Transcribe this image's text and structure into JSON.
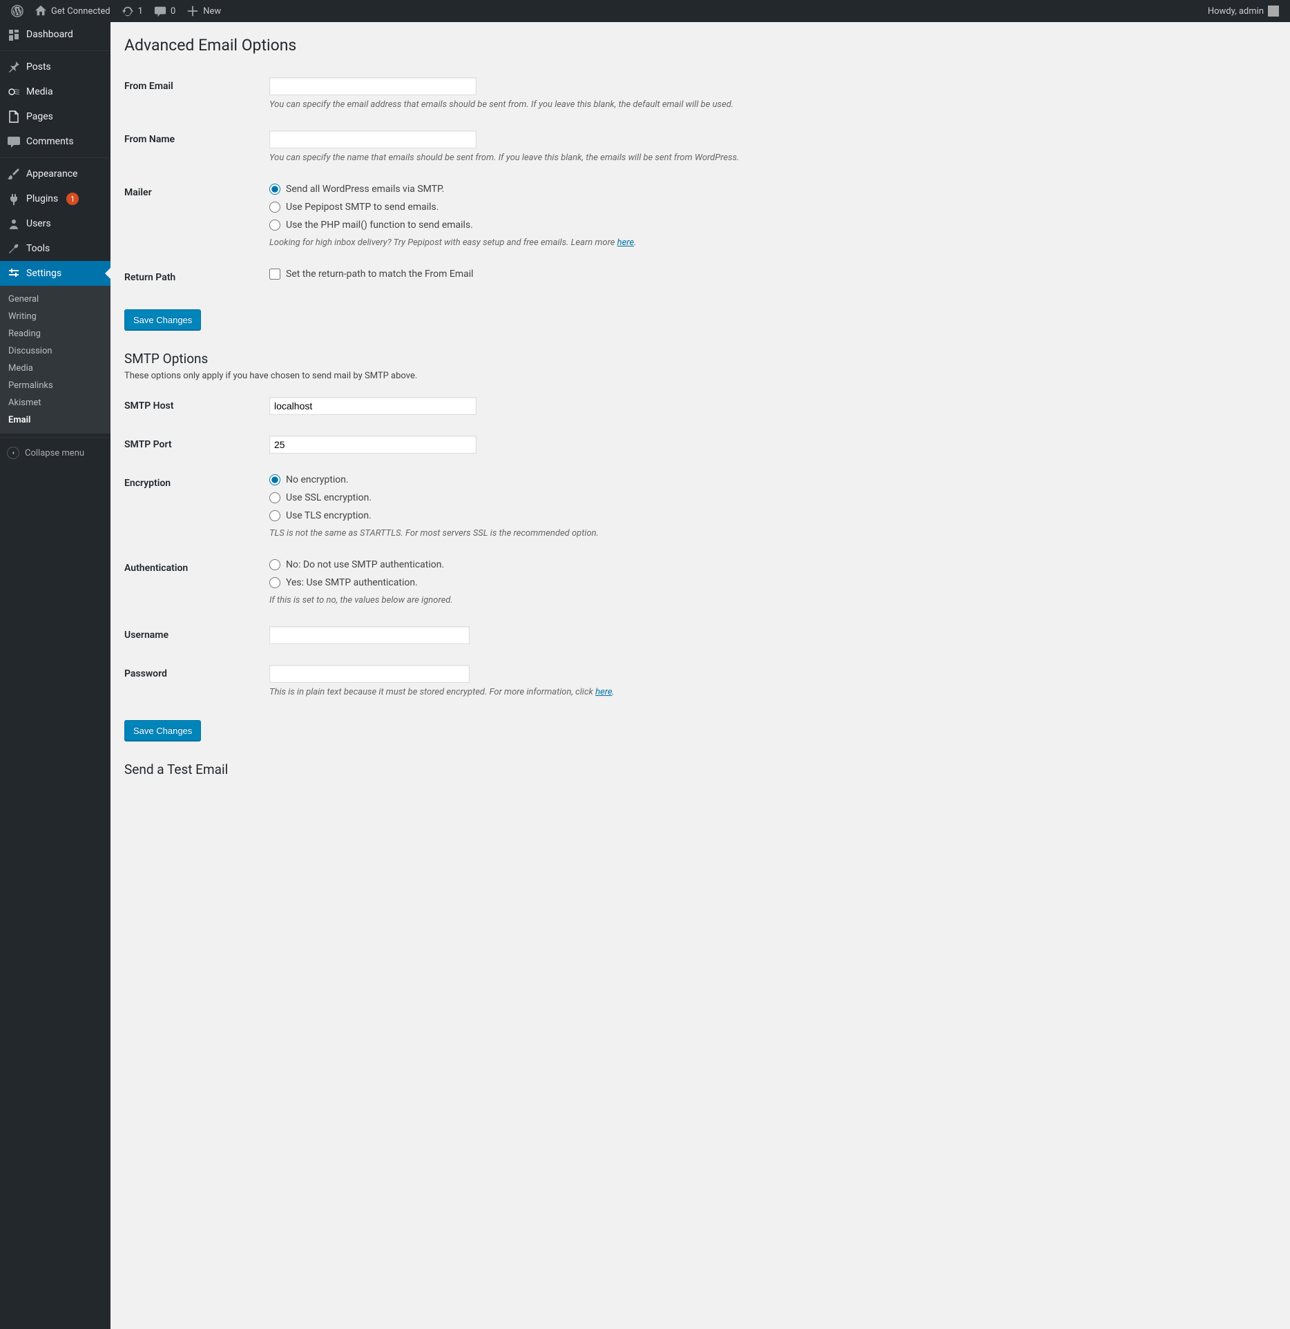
{
  "adminbar": {
    "site_name": "Get Connected",
    "updates_count": "1",
    "comments_count": "0",
    "new_label": "New",
    "howdy": "Howdy, admin"
  },
  "sidebar": {
    "items": [
      {
        "label": "Dashboard"
      },
      {
        "label": "Posts"
      },
      {
        "label": "Media"
      },
      {
        "label": "Pages"
      },
      {
        "label": "Comments"
      },
      {
        "label": "Appearance"
      },
      {
        "label": "Plugins",
        "badge": "1"
      },
      {
        "label": "Users"
      },
      {
        "label": "Tools"
      },
      {
        "label": "Settings"
      }
    ],
    "submenu": [
      {
        "label": "General"
      },
      {
        "label": "Writing"
      },
      {
        "label": "Reading"
      },
      {
        "label": "Discussion"
      },
      {
        "label": "Media"
      },
      {
        "label": "Permalinks"
      },
      {
        "label": "Akismet"
      },
      {
        "label": "Email"
      }
    ],
    "collapse_label": "Collapse menu"
  },
  "page": {
    "title": "Advanced Email Options",
    "section2_title": "SMTP Options",
    "section2_note": "These options only apply if you have chosen to send mail by SMTP above.",
    "section3_title": "Send a Test Email",
    "fields": {
      "from_email": {
        "label": "From Email",
        "value": "",
        "desc": "You can specify the email address that emails should be sent from. If you leave this blank, the default email will be used."
      },
      "from_name": {
        "label": "From Name",
        "value": "",
        "desc": "You can specify the name that emails should be sent from. If you leave this blank, the emails will be sent from WordPress."
      },
      "mailer": {
        "label": "Mailer",
        "opts": [
          "Send all WordPress emails via SMTP.",
          "Use Pepipost SMTP to send emails.",
          "Use the PHP mail() function to send emails."
        ],
        "desc_pre": "Looking for high inbox delivery? Try Pepipost with easy setup and free emails. Learn more ",
        "desc_link": "here"
      },
      "return_path": {
        "label": "Return Path",
        "check_label": "Set the return-path to match the From Email"
      },
      "smtp_host": {
        "label": "SMTP Host",
        "value": "localhost"
      },
      "smtp_port": {
        "label": "SMTP Port",
        "value": "25"
      },
      "encryption": {
        "label": "Encryption",
        "opts": [
          "No encryption.",
          "Use SSL encryption.",
          "Use TLS encryption."
        ],
        "desc": "TLS is not the same as STARTTLS. For most servers SSL is the recommended option."
      },
      "auth": {
        "label": "Authentication",
        "opts": [
          "No: Do not use SMTP authentication.",
          "Yes: Use SMTP authentication."
        ],
        "desc": "If this is set to no, the values below are ignored."
      },
      "username": {
        "label": "Username",
        "value": ""
      },
      "password": {
        "label": "Password",
        "value": "",
        "desc_pre": "This is in plain text because it must be stored encrypted. For more information, click ",
        "desc_link": "here"
      }
    },
    "save_button": "Save Changes"
  }
}
